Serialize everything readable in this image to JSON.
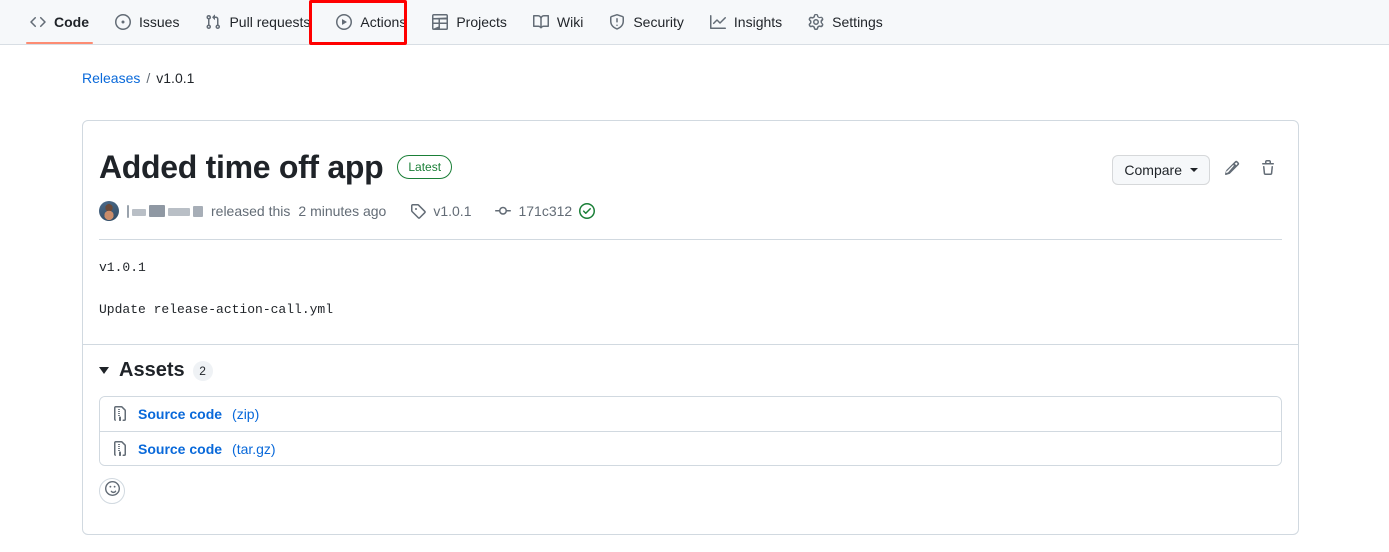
{
  "repo_nav": {
    "items": [
      {
        "label": "Code",
        "icon": "code-icon",
        "selected": true
      },
      {
        "label": "Issues",
        "icon": "issue-opened-icon",
        "selected": false
      },
      {
        "label": "Pull requests",
        "icon": "git-pull-request-icon",
        "selected": false
      },
      {
        "label": "Actions",
        "icon": "play-icon",
        "selected": false
      },
      {
        "label": "Projects",
        "icon": "table-icon",
        "selected": false
      },
      {
        "label": "Wiki",
        "icon": "book-icon",
        "selected": false
      },
      {
        "label": "Security",
        "icon": "shield-icon",
        "selected": false
      },
      {
        "label": "Insights",
        "icon": "graph-icon",
        "selected": false
      },
      {
        "label": "Settings",
        "icon": "gear-icon",
        "selected": false
      }
    ],
    "highlight": {
      "target": "Actions",
      "color": "#ff0000"
    },
    "active_underline_color": "#fd8c73"
  },
  "breadcrumb": {
    "root_label": "Releases",
    "separator": "/",
    "current_label": "v1.0.1"
  },
  "release": {
    "title": "Added time off app",
    "badge": "Latest",
    "badge_color": "#1a7f37",
    "actions": {
      "compare_label": "Compare",
      "edit_icon": "pencil-icon",
      "delete_icon": "trash-icon"
    },
    "meta": {
      "author_redacted": true,
      "released_text": "released this",
      "time_ago": "2 minutes ago",
      "tag": "v1.0.1",
      "commit": "171c312",
      "verified_icon": "verified-check-icon"
    },
    "body_lines": [
      "v1.0.1",
      "Update release-action-call.yml"
    ]
  },
  "assets": {
    "title": "Assets",
    "count": "2",
    "expanded": true,
    "items": [
      {
        "name": "Source code",
        "ext": "(zip)",
        "icon": "file-zip-icon"
      },
      {
        "name": "Source code",
        "ext": "(tar.gz)",
        "icon": "file-zip-icon"
      }
    ]
  },
  "reactions": {
    "add_icon": "smiley-icon"
  }
}
